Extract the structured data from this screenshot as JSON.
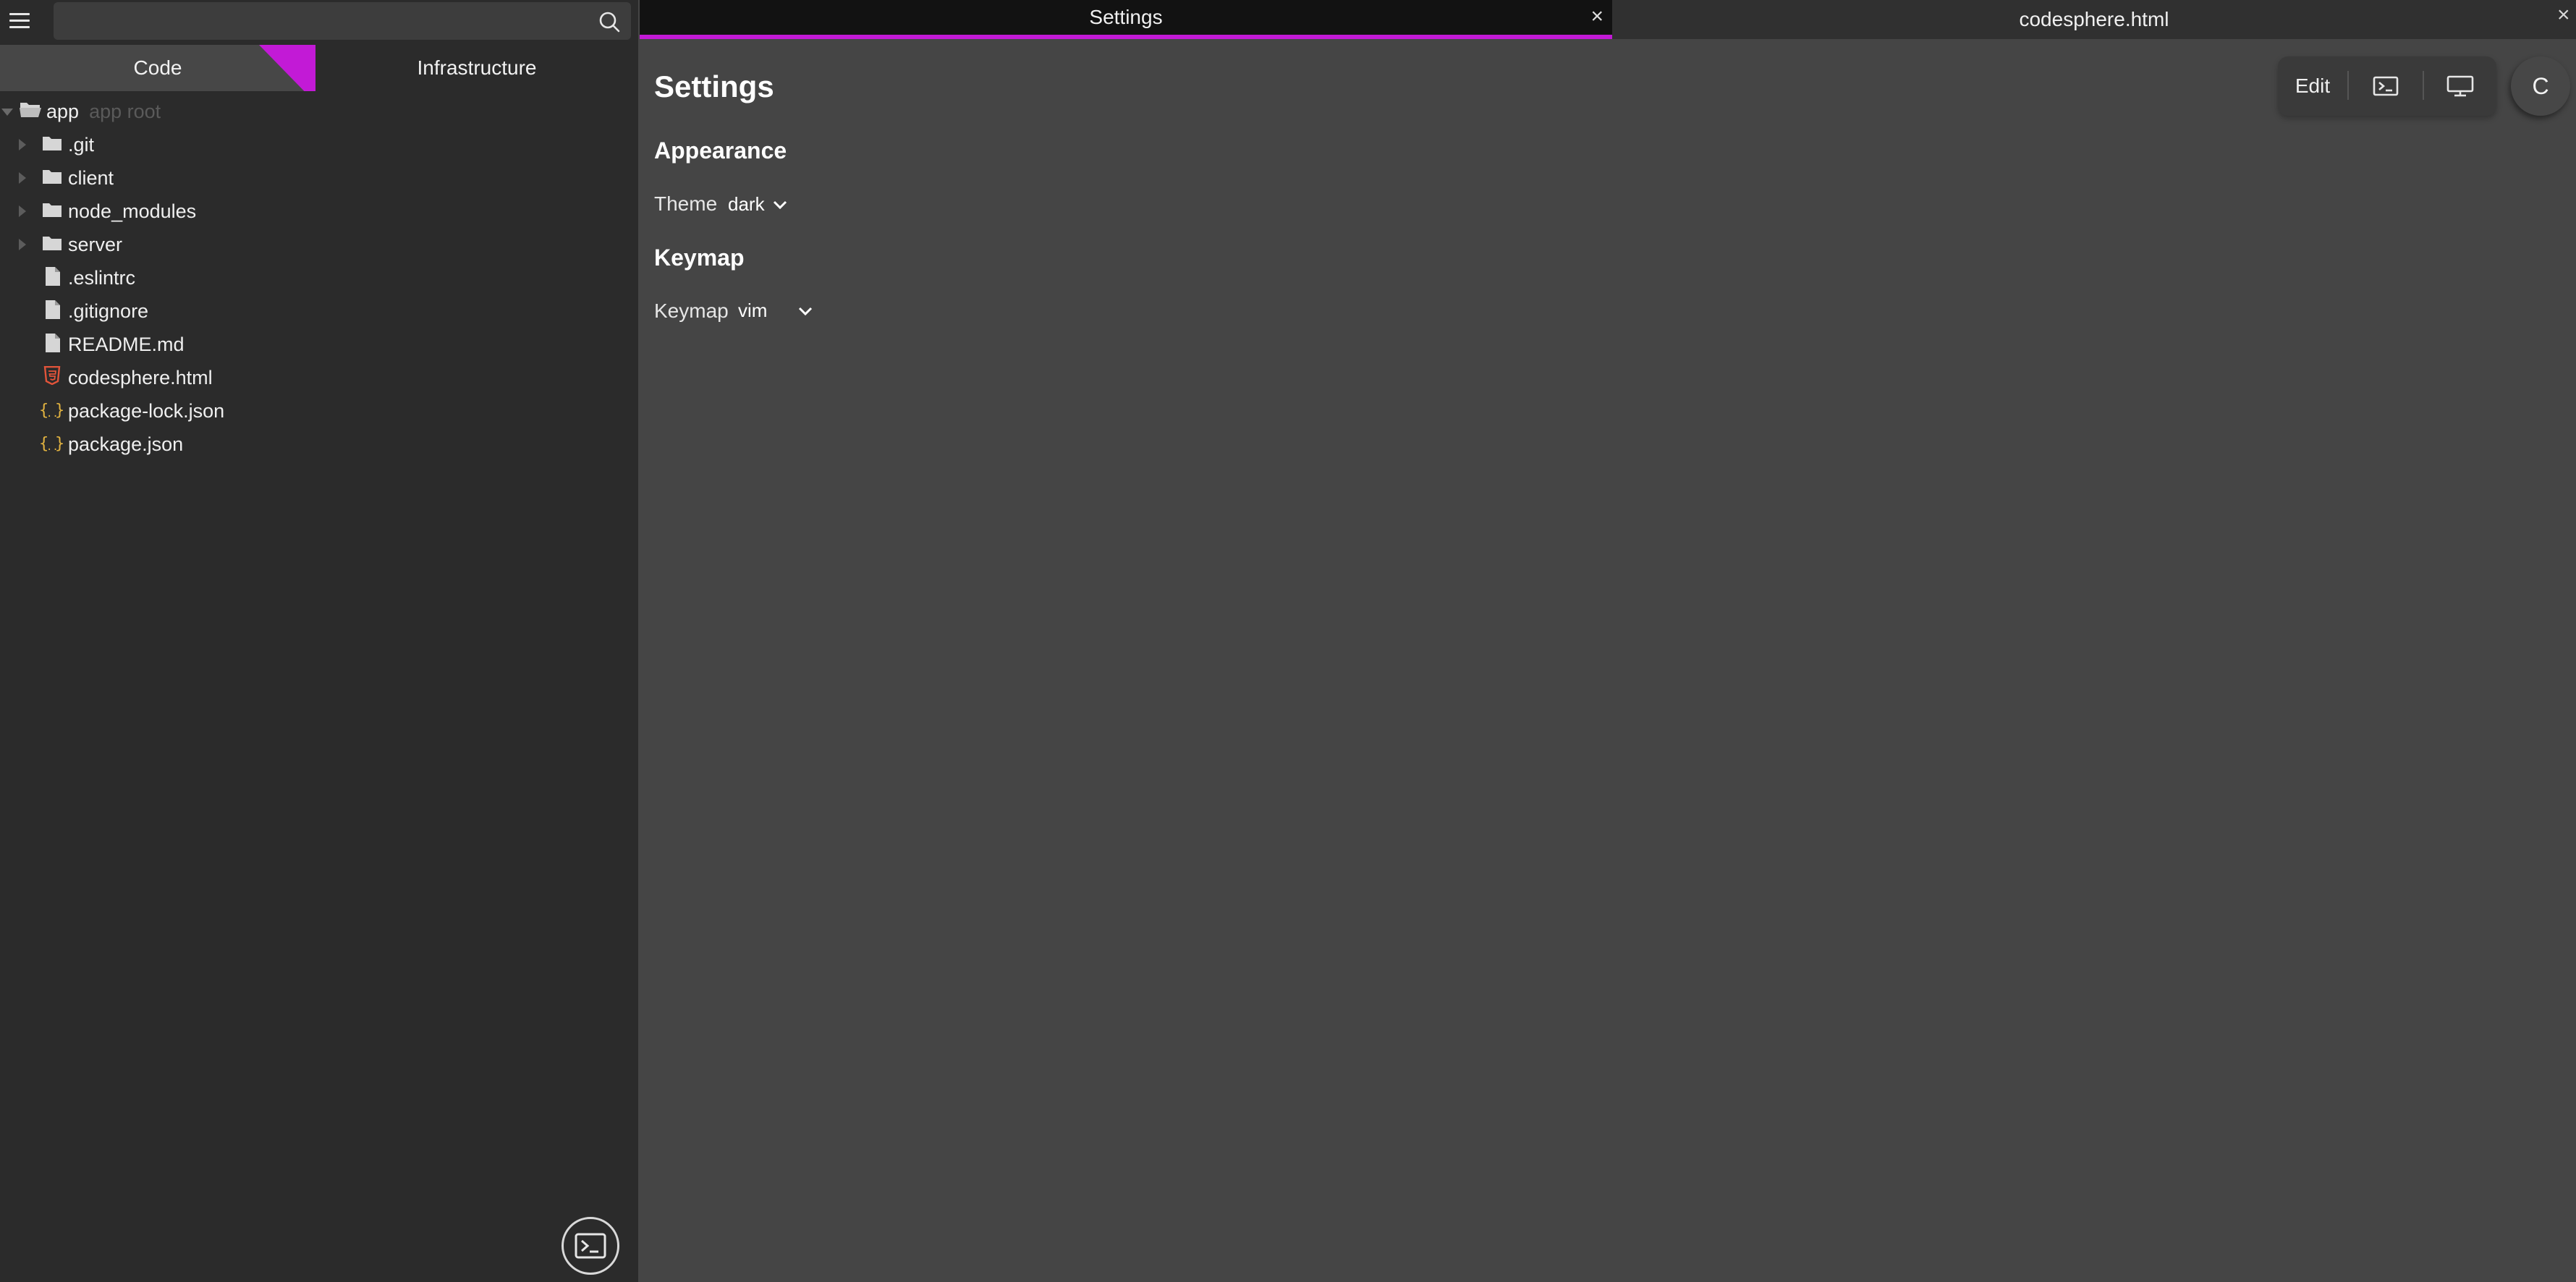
{
  "sidebar": {
    "search": {
      "value": "",
      "placeholder": ""
    },
    "tabs": [
      {
        "label": "Code",
        "active": true
      },
      {
        "label": "Infrastructure",
        "active": false
      }
    ],
    "tree": {
      "root": {
        "label": "app",
        "hint": "app root"
      },
      "folders": [
        ".git",
        "client",
        "node_modules",
        "server"
      ],
      "files": [
        {
          "name": ".eslintrc",
          "icon": "file-icon"
        },
        {
          "name": ".gitignore",
          "icon": "file-icon"
        },
        {
          "name": "README.md",
          "icon": "file-icon"
        },
        {
          "name": "codesphere.html",
          "icon": "html5-icon"
        },
        {
          "name": "package-lock.json",
          "icon": "json-icon"
        },
        {
          "name": "package.json",
          "icon": "json-icon"
        }
      ]
    }
  },
  "editor": {
    "tabs": [
      {
        "label": "Settings",
        "active": true
      },
      {
        "label": "codesphere.html",
        "active": false
      }
    ]
  },
  "settings": {
    "title": "Settings",
    "appearance": {
      "heading": "Appearance",
      "theme_label": "Theme",
      "theme_value": "dark"
    },
    "keymap": {
      "heading": "Keymap",
      "keymap_label": "Keymap",
      "keymap_value": "vim"
    }
  },
  "toolbar": {
    "edit_label": "Edit"
  },
  "avatar": {
    "initial": "C"
  },
  "colors": {
    "accent": "#c21ad6",
    "sidebar_bg": "#2b2b2b",
    "main_bg": "#454545",
    "html_icon": "#e2543a",
    "json_icon": "#e2b340"
  }
}
